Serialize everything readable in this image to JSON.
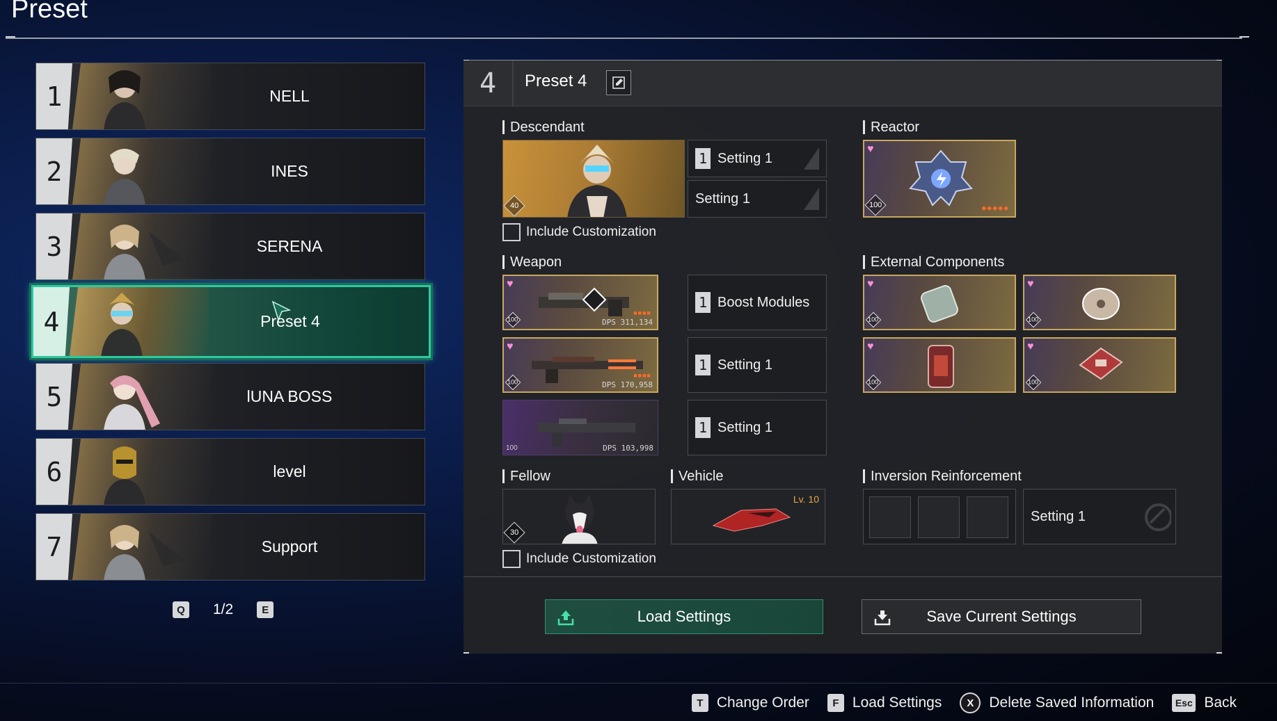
{
  "screen": {
    "title": "Preset"
  },
  "preset_list": {
    "items": [
      {
        "num": "1",
        "name": "NELL"
      },
      {
        "num": "2",
        "name": "INES"
      },
      {
        "num": "3",
        "name": "SERENA"
      },
      {
        "num": "4",
        "name": "Preset 4"
      },
      {
        "num": "5",
        "name": "lUNA BOSS"
      },
      {
        "num": "6",
        "name": "level"
      },
      {
        "num": "7",
        "name": "Support"
      }
    ],
    "active_index": 3,
    "pager": {
      "prev_key": "Q",
      "page": "1/2",
      "next_key": "E"
    }
  },
  "panel": {
    "number": "4",
    "title": "Preset 4",
    "descendant": {
      "label": "Descendant",
      "level": "40",
      "setting_1": "Setting 1",
      "setting_2": "Setting 1",
      "include_customization": "Include Customization"
    },
    "reactor": {
      "label": "Reactor",
      "level": "100",
      "stars": "◆◆◆◆◆"
    },
    "weapon": {
      "label": "Weapon",
      "items": [
        {
          "level": "100",
          "dps_label": "DPS",
          "dps": "311,134",
          "setting": "Boost Modules"
        },
        {
          "level": "100",
          "dps_label": "DPS",
          "dps": "170,958",
          "setting": "Setting 1"
        },
        {
          "level": "100",
          "dps_label": "DPS",
          "dps": "103,998",
          "setting": "Setting 1"
        }
      ]
    },
    "external_components": {
      "label": "External Components",
      "levels": [
        "100",
        "100",
        "100",
        "100"
      ]
    },
    "fellow": {
      "label": "Fellow",
      "level": "30",
      "include_customization": "Include Customization"
    },
    "vehicle": {
      "label": "Vehicle",
      "level": "Lv. 10"
    },
    "inversion": {
      "label": "Inversion Reinforcement",
      "setting": "Setting 1"
    },
    "buttons": {
      "load": "Load Settings",
      "save": "Save Current Settings"
    }
  },
  "hints": [
    {
      "key": "T",
      "label": "Change Order"
    },
    {
      "key": "F",
      "label": "Load Settings"
    },
    {
      "key": "X",
      "label": "Delete Saved Information"
    },
    {
      "key": "Esc",
      "label": "Back"
    }
  ],
  "colors": {
    "accent": "#2ec9a0",
    "gold": "#c9a85e",
    "panel": "#222326"
  }
}
